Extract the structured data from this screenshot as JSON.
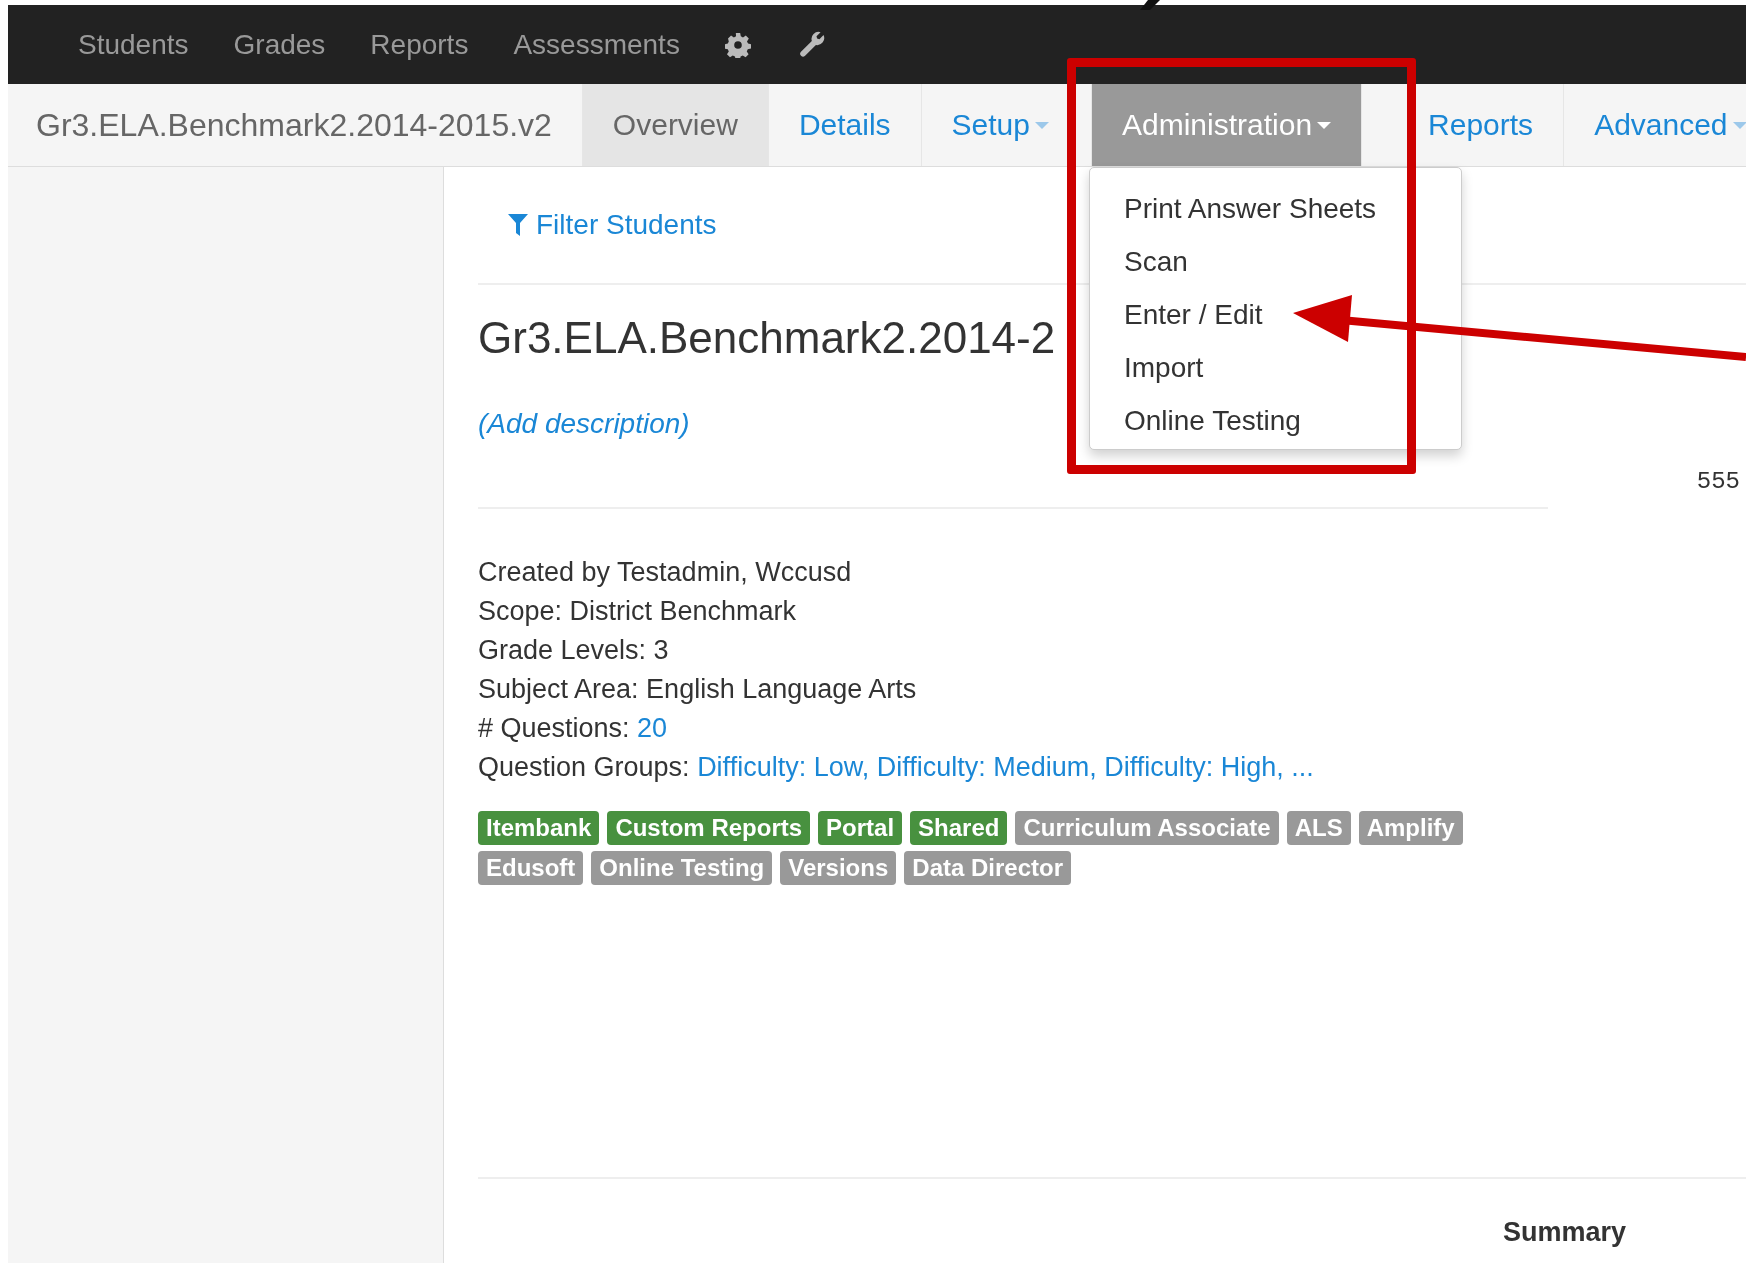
{
  "top_nav": {
    "items": [
      "Students",
      "Grades",
      "Reports",
      "Assessments"
    ]
  },
  "subnav": {
    "title": "Gr3.ELA.Benchmark2.2014-2015.v2",
    "tabs": [
      {
        "label": "Overview",
        "selected": true,
        "has_menu": false,
        "expanded": false
      },
      {
        "label": "Details",
        "selected": false,
        "has_menu": false,
        "expanded": false
      },
      {
        "label": "Setup",
        "selected": false,
        "has_menu": true,
        "expanded": false
      },
      {
        "label": "Administration",
        "selected": false,
        "has_menu": true,
        "expanded": true
      },
      {
        "label": "Reports",
        "selected": false,
        "has_menu": false,
        "expanded": false
      },
      {
        "label": "Advanced",
        "selected": false,
        "has_menu": true,
        "expanded": false
      }
    ]
  },
  "dropdown": {
    "items": [
      "Print Answer Sheets",
      "Scan",
      "Enter / Edit",
      "Import",
      "Online Testing"
    ]
  },
  "content": {
    "filter_link": "Filter Students",
    "title": "Gr3.ELA.Benchmark2.2014-2",
    "add_description": "(Add description)",
    "side_number": "555",
    "details": [
      {
        "text": "Created by Testadmin, Wccusd"
      },
      {
        "text": "Scope: District Benchmark"
      },
      {
        "text": "Grade Levels: 3"
      },
      {
        "text": "Subject Area: English Language Arts"
      },
      {
        "text": "# Questions: ",
        "link": "20"
      },
      {
        "text": "Question Groups: ",
        "link": "Difficulty: Low, Difficulty: Medium, Difficulty: High, ..."
      }
    ],
    "tags": [
      {
        "label": "Itembank",
        "color": "#48913f"
      },
      {
        "label": "Custom Reports",
        "color": "#48913f"
      },
      {
        "label": "Portal",
        "color": "#48913f"
      },
      {
        "label": "Shared",
        "color": "#48913f"
      },
      {
        "label": "Curriculum Associate",
        "color": "#999999"
      },
      {
        "label": "ALS",
        "color": "#999999"
      },
      {
        "label": "Amplify",
        "color": "#999999"
      },
      {
        "label": "Edusoft",
        "color": "#999999"
      },
      {
        "label": "Online Testing",
        "color": "#999999"
      },
      {
        "label": "Versions",
        "color": "#999999"
      },
      {
        "label": "Data Director",
        "color": "#999999"
      }
    ],
    "summary_heading": "Summary"
  }
}
